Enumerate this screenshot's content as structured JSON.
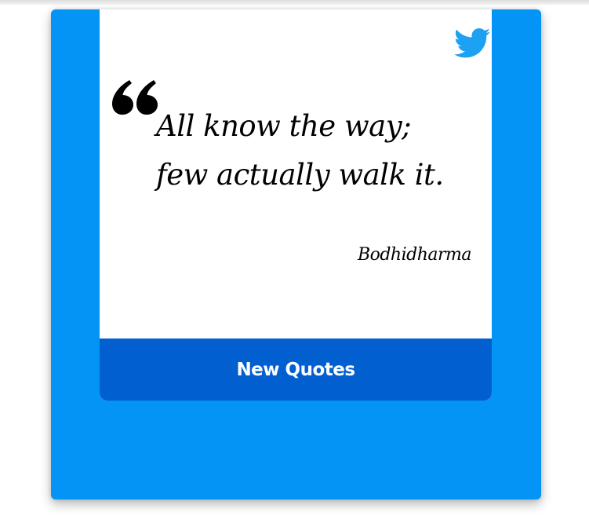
{
  "quote": {
    "text": "All know the way; few actually walk it.",
    "author": "Bodhidharma"
  },
  "actions": {
    "new_quote_label": "New Quotes"
  },
  "icons": {
    "share": "twitter-icon",
    "quote": "quote-mark-icon"
  },
  "colors": {
    "background": "#0394f5",
    "card": "#ffffff",
    "button": "#025fd0",
    "twitter": "#1da1f2",
    "text": "#000000"
  }
}
